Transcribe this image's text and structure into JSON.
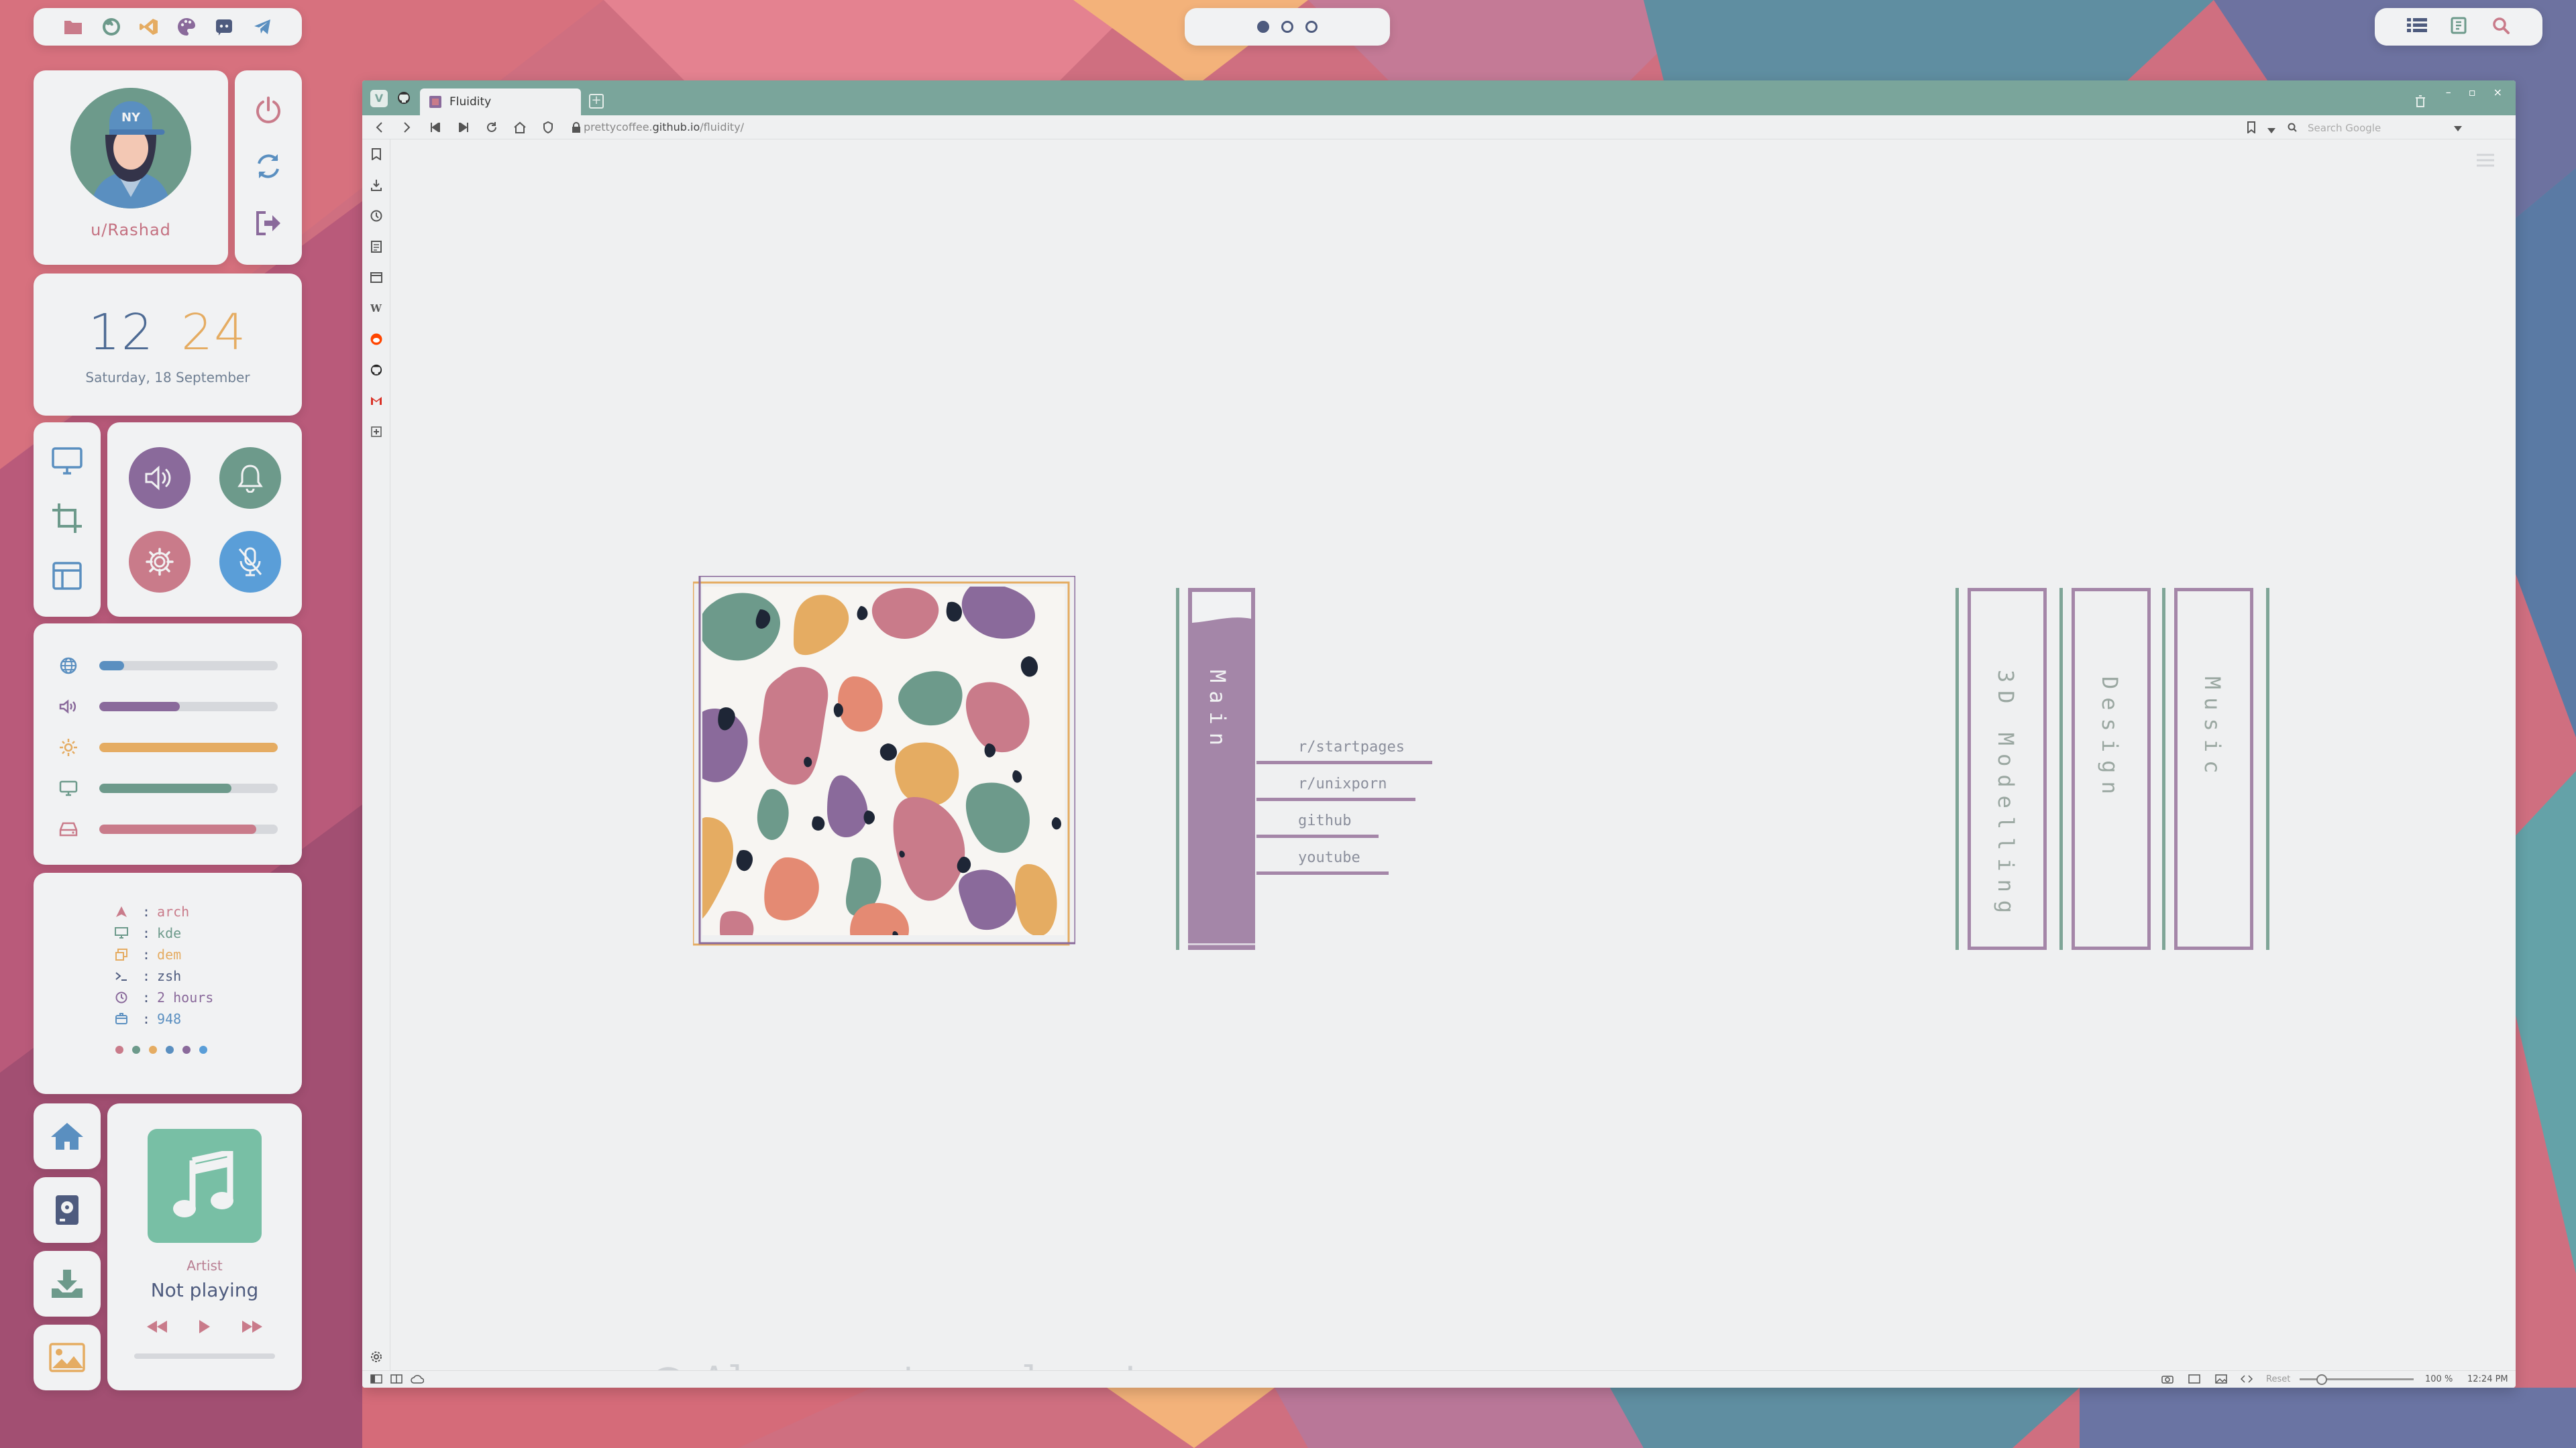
{
  "colors": {
    "pink": "#c97b8a",
    "purple": "#8a6a9b",
    "orange": "#e5ac62",
    "green": "#6d9a8b",
    "blue": "#5a8fc0",
    "navy": "#4e5b7e",
    "light": "#f1f2f3"
  },
  "topbar": {
    "left_icons": [
      "folder-icon",
      "firefox-icon",
      "vscode-icon",
      "palette-icon",
      "discord-icon",
      "telegram-icon"
    ],
    "workspaces": [
      true,
      false,
      false
    ],
    "right_icons": [
      "list-icon",
      "notes-icon",
      "search-icon"
    ]
  },
  "profile": {
    "avatar_cap_text": "NY",
    "username": "u/Rashad"
  },
  "power_icons": [
    "power-icon",
    "restart-icon",
    "logout-icon"
  ],
  "clock": {
    "hours": "12",
    "minutes": "24",
    "date": "Saturday, 18 September"
  },
  "tools": [
    "monitor-icon",
    "crop-icon",
    "layout-icon"
  ],
  "quick_buttons": [
    "volume-icon",
    "bell-icon",
    "settings-icon",
    "mic-off-icon"
  ],
  "sliders": [
    {
      "icon": "globe-icon",
      "value": 0.14,
      "color": "#5a8fc0"
    },
    {
      "icon": "volume-icon",
      "value": 0.45,
      "color": "#8a6a9b"
    },
    {
      "icon": "sun-icon",
      "value": 1.0,
      "color": "#e5ac62"
    },
    {
      "icon": "monitor-icon",
      "value": 0.74,
      "color": "#6d9a8b"
    },
    {
      "icon": "disk-icon",
      "value": 0.88,
      "color": "#c97b8a"
    }
  ],
  "sysinfo": [
    {
      "icon": "arch-icon",
      "value": "arch",
      "color": "#c97b8a"
    },
    {
      "icon": "monitor-icon",
      "value": "kde",
      "color": "#6d9a8b"
    },
    {
      "icon": "window-icon",
      "value": "dem",
      "color": "#e5ac62"
    },
    {
      "icon": "terminal-icon",
      "value": "zsh",
      "color": "#4e5b7e"
    },
    {
      "icon": "clock-icon",
      "value": "2 hours",
      "color": "#8a6a9b"
    },
    {
      "icon": "package-icon",
      "value": "948",
      "color": "#5a8fc0"
    }
  ],
  "palette": [
    "#c97b8a",
    "#6d9a8b",
    "#e5ac62",
    "#5a8fc0",
    "#8a6a9b",
    "#5a9ed8"
  ],
  "dock": [
    "home-icon",
    "disk-drive-icon",
    "download-icon",
    "image-icon"
  ],
  "music": {
    "artist": "Artist",
    "title": "Not playing"
  },
  "browser": {
    "tab_title": "Fluidity",
    "url_prefix": "prettycoffee.",
    "url_domain": "github.io",
    "url_path": "/fluidity/",
    "search_placeholder": "Search Google",
    "zoom_reset": "Reset",
    "zoom": "100 %",
    "time": "12:24 PM"
  },
  "startpage": {
    "main_label": "Main",
    "links": [
      "r/startpages",
      "r/unixporn",
      "github",
      "youtube"
    ],
    "categories": [
      "3D Modelling",
      "Design",
      "Music"
    ],
    "motto": "Always stay clean!"
  }
}
